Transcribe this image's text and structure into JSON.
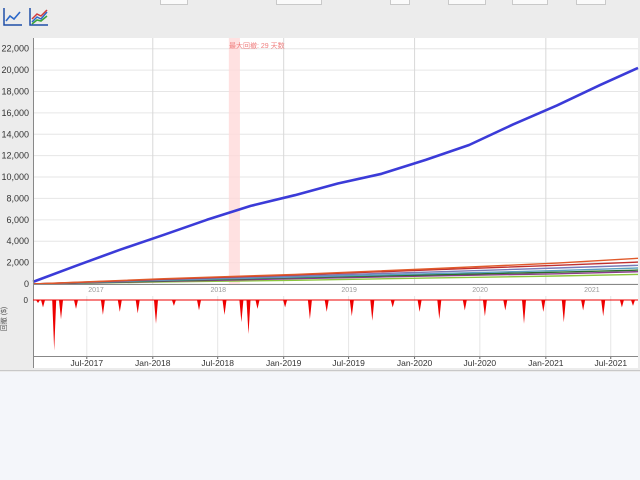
{
  "toolbar": {
    "buttons": [
      {
        "icon": "line-chart-icon"
      },
      {
        "icon": "multi-line-chart-icon"
      }
    ]
  },
  "chart_data": [
    {
      "type": "line",
      "subtype": "equity-curve",
      "title": "",
      "annotation": "最大回撤: 29 天数",
      "ylim": [
        0,
        23000
      ],
      "yticks": [
        0,
        2000,
        4000,
        6000,
        8000,
        10000,
        12000,
        14000,
        16000,
        18000,
        20000,
        22000
      ],
      "ytick_labels": [
        "0",
        "2,000",
        "4,000",
        "6,000",
        "8,000",
        "10,000",
        "12,000",
        "14,000",
        "16,000",
        "18,000",
        "20,000",
        "22,000"
      ],
      "x_year_labels": [
        "2017",
        "2018",
        "2019",
        "2020",
        "2021"
      ],
      "xlim": [
        "2017-02-01",
        "2021-09-15"
      ],
      "highlight_range": [
        "2018-08-01",
        "2018-09-01"
      ],
      "grid": true,
      "series": [
        {
          "name": "",
          "color": "#3b3bd8",
          "x": [
            "2017-02-01",
            "2017-06-01",
            "2017-10-01",
            "2018-02-01",
            "2018-06-01",
            "2018-10-01",
            "2019-02-01",
            "2019-06-01",
            "2019-10-01",
            "2020-02-01",
            "2020-06-01",
            "2020-10-01",
            "2021-02-01",
            "2021-06-01",
            "2021-09-15"
          ],
          "values": [
            200,
            1700,
            3200,
            4600,
            6000,
            7300,
            8300,
            9400,
            10300,
            11600,
            13000,
            14900,
            16700,
            18600,
            20200
          ]
        },
        {
          "name": "",
          "color": "#e05a2b",
          "x": [
            "2017-02-01",
            "2018-02-01",
            "2019-02-01",
            "2020-02-01",
            "2021-02-01",
            "2021-09-15"
          ],
          "values": [
            0,
            500,
            900,
            1400,
            1950,
            2400
          ]
        },
        {
          "name": "",
          "color": "#c03030",
          "x": [
            "2017-02-01",
            "2018-02-01",
            "2019-02-01",
            "2020-02-01",
            "2021-02-01",
            "2021-09-15"
          ],
          "values": [
            0,
            450,
            850,
            1300,
            1750,
            2050
          ]
        },
        {
          "name": "",
          "color": "#7a7ab8",
          "x": [
            "2017-02-01",
            "2018-02-01",
            "2019-02-01",
            "2020-02-01",
            "2021-02-01",
            "2021-09-15"
          ],
          "values": [
            0,
            400,
            750,
            1100,
            1500,
            1750
          ]
        },
        {
          "name": "",
          "color": "#5a9fc0",
          "x": [
            "2017-02-01",
            "2018-02-01",
            "2019-02-01",
            "2020-02-01",
            "2021-02-01",
            "2021-09-15"
          ],
          "values": [
            0,
            350,
            650,
            950,
            1250,
            1500
          ]
        },
        {
          "name": "",
          "color": "#2a6e2a",
          "x": [
            "2017-02-01",
            "2018-02-01",
            "2019-02-01",
            "2020-02-01",
            "2021-02-01",
            "2021-09-15"
          ],
          "values": [
            0,
            300,
            600,
            850,
            1100,
            1300
          ]
        },
        {
          "name": "",
          "color": "#8a3a8a",
          "x": [
            "2017-02-01",
            "2018-02-01",
            "2019-02-01",
            "2020-02-01",
            "2021-02-01",
            "2021-09-15"
          ],
          "values": [
            0,
            250,
            500,
            750,
            950,
            1150
          ]
        },
        {
          "name": "",
          "color": "#8cc63e",
          "x": [
            "2017-02-01",
            "2018-02-01",
            "2019-02-01",
            "2020-02-01",
            "2021-02-01",
            "2021-09-15"
          ],
          "values": [
            0,
            200,
            350,
            550,
            750,
            900
          ]
        }
      ]
    },
    {
      "type": "area",
      "subtype": "drawdown",
      "ylabel": "回撤 ($)",
      "ytick_labels": [
        "0"
      ],
      "ylim": [
        -3500,
        0
      ],
      "x_tick_labels": [
        "Jul-2017",
        "Jan-2018",
        "Jul-2018",
        "Jan-2019",
        "Jul-2019",
        "Jan-2020",
        "Jul-2020",
        "Jan-2021",
        "Jul-2021"
      ],
      "x_tick_dates": [
        "2017-07-01",
        "2018-01-01",
        "2018-07-01",
        "2019-01-01",
        "2019-07-01",
        "2020-01-01",
        "2020-07-01",
        "2021-01-01",
        "2021-07-01"
      ],
      "color": "#ee0000",
      "x": [
        "2017-02-15",
        "2017-03-01",
        "2017-04-01",
        "2017-04-20",
        "2017-06-01",
        "2017-08-15",
        "2017-10-01",
        "2017-11-20",
        "2018-01-10",
        "2018-03-01",
        "2018-05-10",
        "2018-07-20",
        "2018-09-05",
        "2018-09-25",
        "2018-10-20",
        "2019-01-05",
        "2019-03-15",
        "2019-05-01",
        "2019-07-10",
        "2019-09-05",
        "2019-11-01",
        "2020-01-15",
        "2020-03-10",
        "2020-05-20",
        "2020-07-15",
        "2020-09-10",
        "2020-11-01",
        "2020-12-25",
        "2021-02-20",
        "2021-04-15",
        "2021-06-10",
        "2021-08-01",
        "2021-09-01"
      ],
      "values": [
        -200,
        -500,
        -3400,
        -1300,
        -600,
        -1000,
        -800,
        -900,
        -1600,
        -400,
        -700,
        -1000,
        -1500,
        -2300,
        -600,
        -500,
        -1300,
        -800,
        -1100,
        -1400,
        -500,
        -800,
        -1300,
        -700,
        -1100,
        -700,
        -1600,
        -800,
        -1500,
        -700,
        -1100,
        -500,
        -400
      ]
    }
  ]
}
